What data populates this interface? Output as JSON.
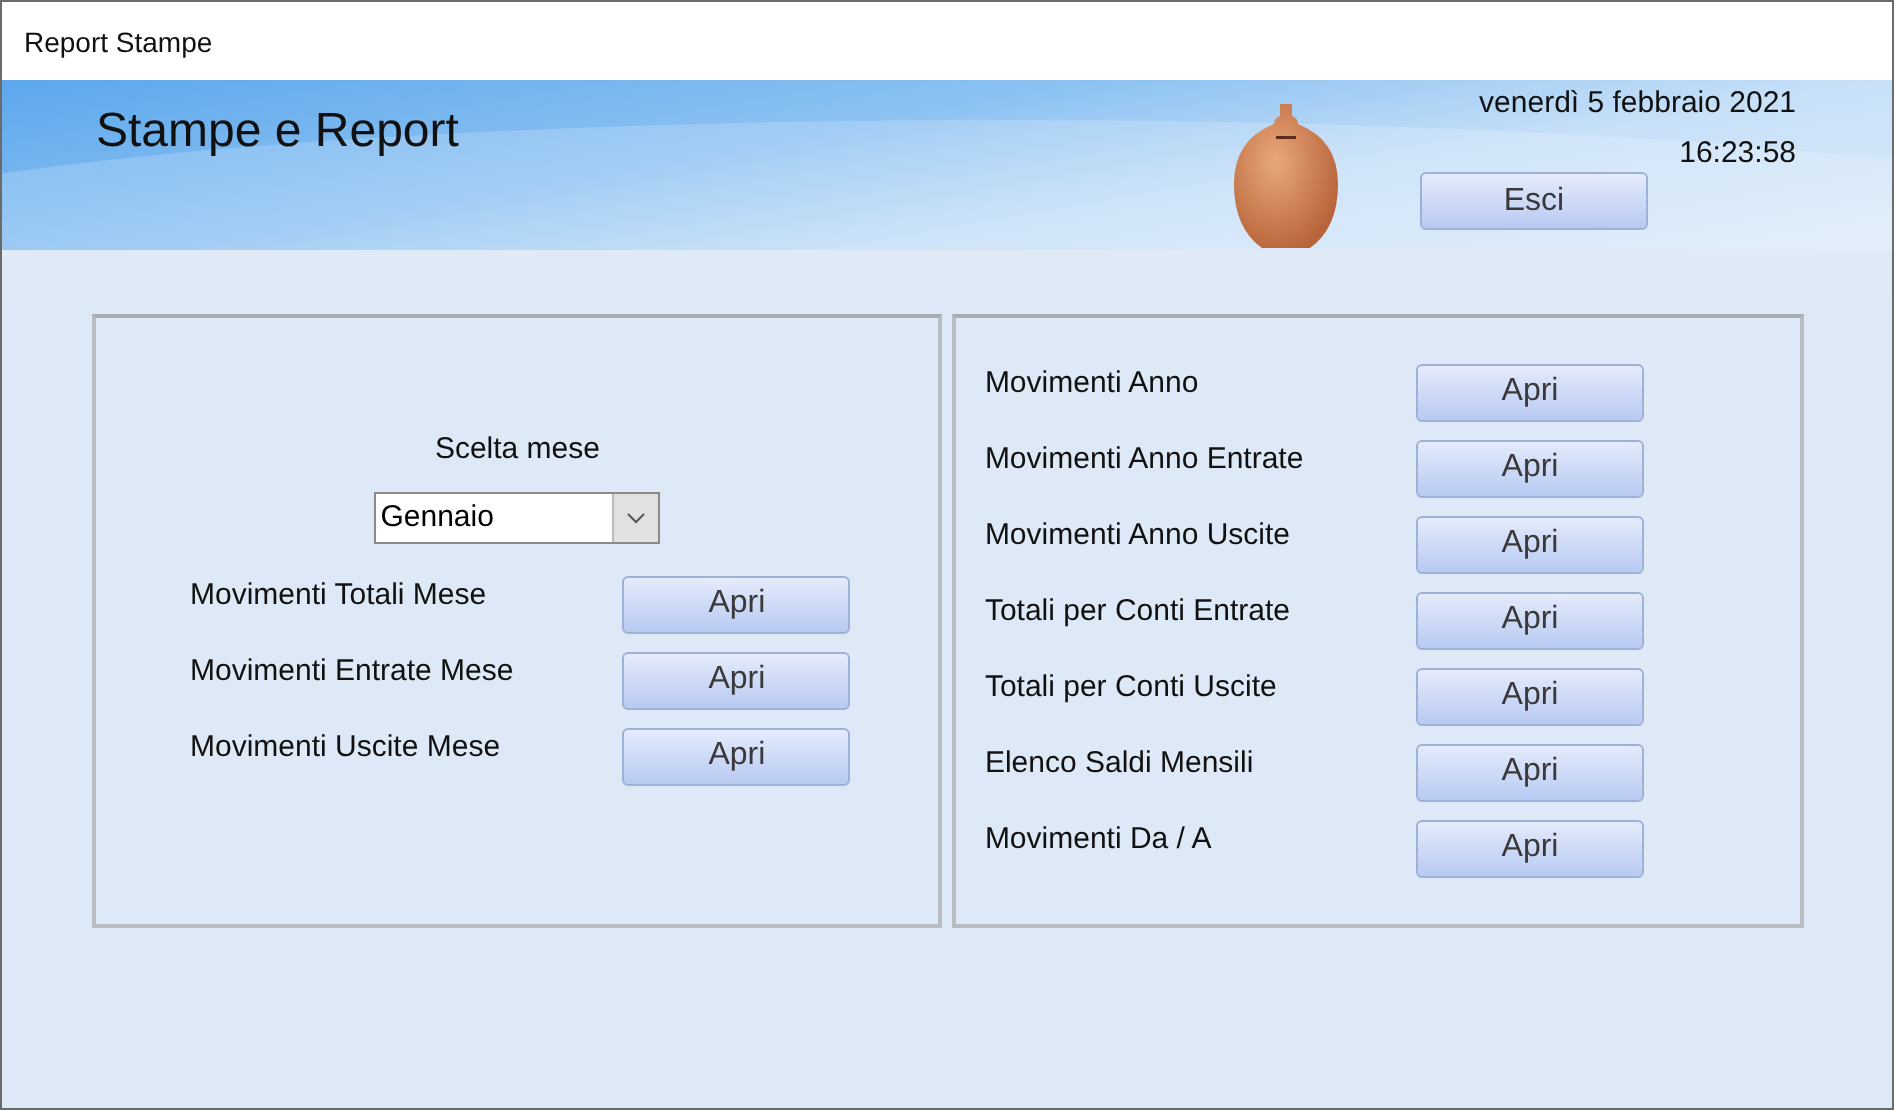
{
  "window": {
    "title": "Report Stampe"
  },
  "header": {
    "title": "Stampe e Report",
    "date": "venerdì 5 febbraio 2021",
    "time": "16:23:58",
    "exit_button": "Esci"
  },
  "month_panel": {
    "label": "Scelta mese",
    "month_select": {
      "value": "Gennaio"
    },
    "reports": [
      {
        "label": "Movimenti Totali Mese",
        "button": "Apri"
      },
      {
        "label": "Movimenti Entrate Mese",
        "button": "Apri"
      },
      {
        "label": "Movimenti Uscite Mese",
        "button": "Apri"
      }
    ]
  },
  "year_panel": {
    "reports": [
      {
        "label": "Movimenti Anno",
        "button": "Apri"
      },
      {
        "label": "Movimenti Anno Entrate",
        "button": "Apri"
      },
      {
        "label": "Movimenti Anno Uscite",
        "button": "Apri"
      },
      {
        "label": "Totali per Conti Entrate",
        "button": "Apri"
      },
      {
        "label": "Totali per Conti Uscite",
        "button": "Apri"
      },
      {
        "label": "Elenco Saldi Mensili",
        "button": "Apri"
      },
      {
        "label": "Movimenti Da / A",
        "button": "Apri"
      }
    ]
  }
}
